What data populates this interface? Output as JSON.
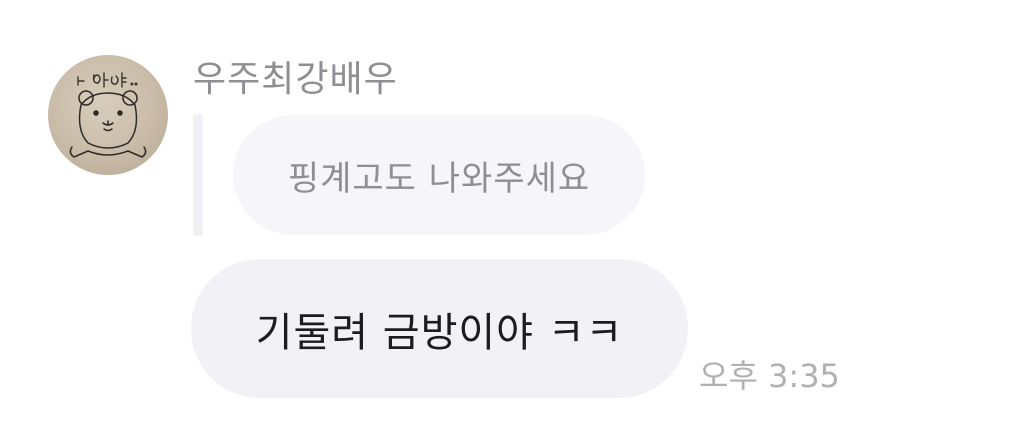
{
  "sender": {
    "name": "우주최강배우",
    "avatar_icon": "bear-drawing-avatar"
  },
  "reply": {
    "quoted_text": "핑계고도 나와주세요"
  },
  "message": {
    "text": "기둘려 금방이야 ㅋㅋ",
    "timestamp": "오후 3:35"
  },
  "colors": {
    "background": "#ffffff",
    "bubble": "#f2f2f6",
    "reply_bubble": "#f6f6fa",
    "secondary_text": "#8e8e93"
  }
}
